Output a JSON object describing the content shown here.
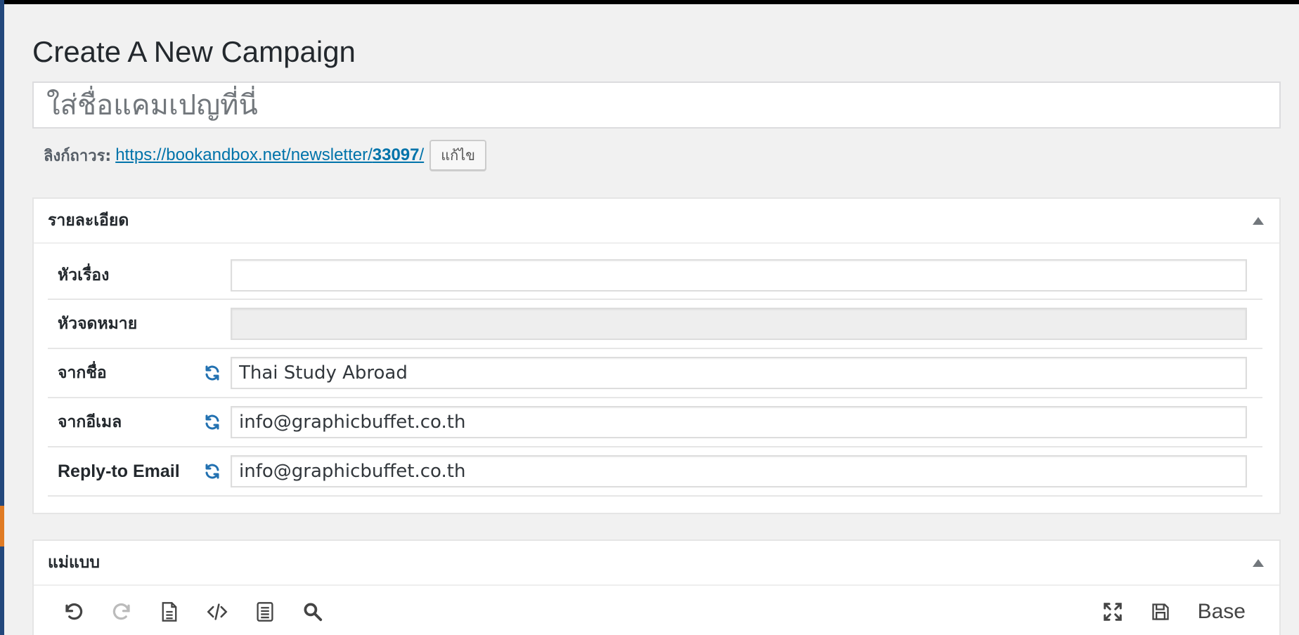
{
  "page": {
    "title": "Create A New Campaign",
    "campaign_name_placeholder": "ใส่ชื่อแคมเปญที่นี่"
  },
  "permalink": {
    "label": "ลิงก์ถาวร:",
    "url_prefix": "https://bookandbox.net/newsletter/",
    "url_slug": "33097",
    "url_suffix": "/",
    "edit_label": "แก้ไข"
  },
  "details": {
    "heading": "รายละเอียด",
    "fields": [
      {
        "label": "หัวเรื่อง",
        "value": "",
        "disabled": false,
        "sync": false
      },
      {
        "label": "หัวจดหมาย",
        "value": "",
        "disabled": true,
        "sync": false
      },
      {
        "label": "จากชื่อ",
        "value": "Thai Study Abroad",
        "disabled": false,
        "sync": true
      },
      {
        "label": "จากอีเมล",
        "value": "info@graphicbuffet.co.th",
        "disabled": false,
        "sync": true
      },
      {
        "label": "Reply-to Email",
        "value": "info@graphicbuffet.co.th",
        "disabled": false,
        "sync": true
      }
    ]
  },
  "template": {
    "heading": "แม่แบบ",
    "toolbar_left": [
      "undo-icon",
      "redo-icon",
      "document-icon",
      "code-icon",
      "list-document-icon",
      "search-icon"
    ],
    "toolbar_right": [
      "fullscreen-icon",
      "save-icon"
    ],
    "base_label": "Base"
  },
  "colors": {
    "link": "#0073aa",
    "sync_icon": "#2271b1",
    "left_strip": "#23487c",
    "left_tab": "#e07b24"
  }
}
